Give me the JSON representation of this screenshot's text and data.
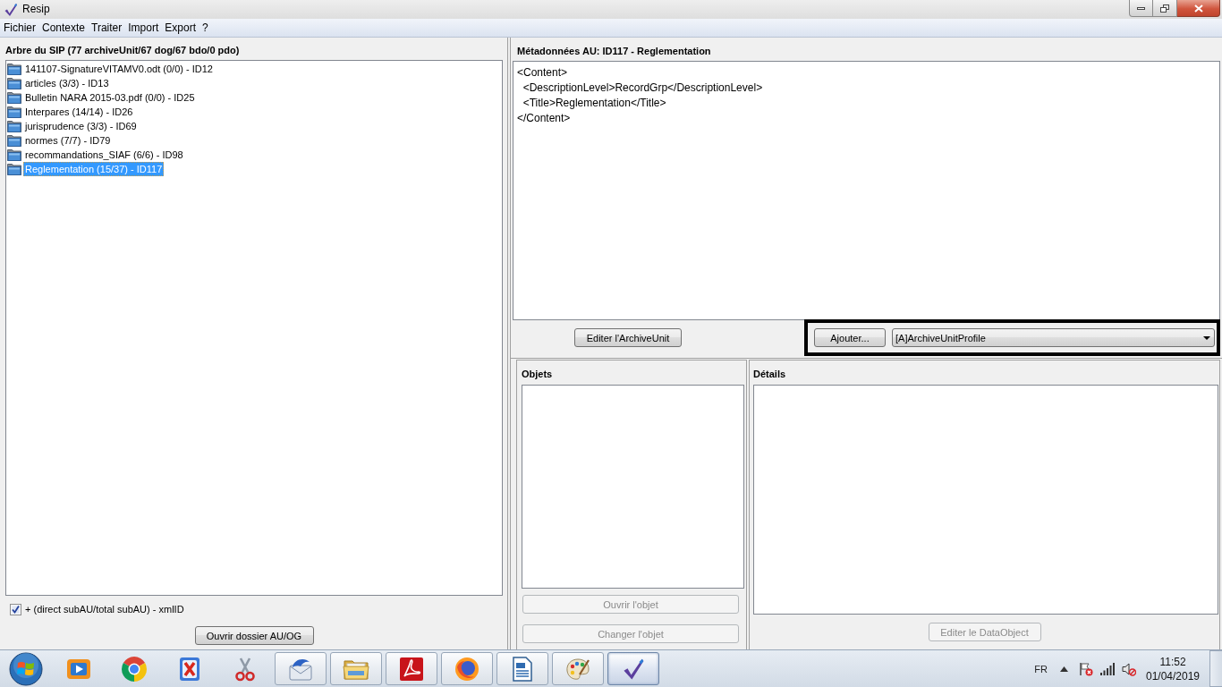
{
  "window": {
    "title": "Resip"
  },
  "menu": [
    "Fichier",
    "Contexte",
    "Traiter",
    "Import",
    "Export",
    "?"
  ],
  "tree_panel": {
    "title": "Arbre du SIP (77 archiveUnit/67 dog/67 bdo/0 pdo)",
    "items": [
      {
        "label": "141107-SignatureVITAMV0.odt (0/0) - ID12",
        "selected": false
      },
      {
        "label": "articles (3/3) - ID13",
        "selected": false
      },
      {
        "label": "Bulletin NARA 2015-03.pdf (0/0) - ID25",
        "selected": false
      },
      {
        "label": "Interpares (14/14) - ID26",
        "selected": false
      },
      {
        "label": "jurisprudence (3/3) - ID69",
        "selected": false
      },
      {
        "label": "normes (7/7) - ID79",
        "selected": false
      },
      {
        "label": "recommandations_SIAF (6/6) - ID98",
        "selected": false
      },
      {
        "label": "Reglementation (15/37) - ID117",
        "selected": true
      }
    ],
    "option": {
      "label": "+ (direct subAU/total subAU) - xmlID",
      "checked": true
    },
    "button": {
      "label": "Ouvrir dossier AU/OG",
      "disabled": false
    }
  },
  "metadata_panel": {
    "title": "Métadonnées AU: ID117 - Reglementation",
    "content": "<Content>\n  <DescriptionLevel>RecordGrp</DescriptionLevel>\n  <Title>Reglementation</Title>\n</Content>",
    "edit_button": {
      "label": "Editer l'ArchiveUnit",
      "disabled": false
    },
    "add_button": {
      "label": "Ajouter...",
      "disabled": false
    },
    "profile_select": {
      "value": "[A]ArchiveUnitProfile"
    }
  },
  "objects_panel": {
    "title": "Objets",
    "buttons": [
      {
        "label": "Ouvrir l'objet",
        "disabled": true
      },
      {
        "label": "Changer l'objet",
        "disabled": true
      }
    ]
  },
  "details_panel": {
    "title": "Détails",
    "button": {
      "label": "Editer le DataObject",
      "disabled": true
    }
  },
  "taskbar": {
    "apps": [
      {
        "kind": "player",
        "running": false,
        "selected": false
      },
      {
        "kind": "wheel",
        "running": false,
        "selected": false
      },
      {
        "kind": "cross",
        "running": false,
        "selected": false
      },
      {
        "kind": "scissors",
        "running": false,
        "selected": false
      },
      {
        "kind": "envelope",
        "running": true,
        "selected": false
      },
      {
        "kind": "folder",
        "running": true,
        "selected": false
      },
      {
        "kind": "swirl",
        "running": true,
        "selected": false
      },
      {
        "kind": "globe",
        "running": true,
        "selected": false
      },
      {
        "kind": "document",
        "running": true,
        "selected": false
      },
      {
        "kind": "palette",
        "running": true,
        "selected": false
      },
      {
        "kind": "tick",
        "running": true,
        "selected": true
      }
    ],
    "tray": {
      "language": "FR",
      "time": "11:52",
      "date": "01/04/2019"
    }
  }
}
